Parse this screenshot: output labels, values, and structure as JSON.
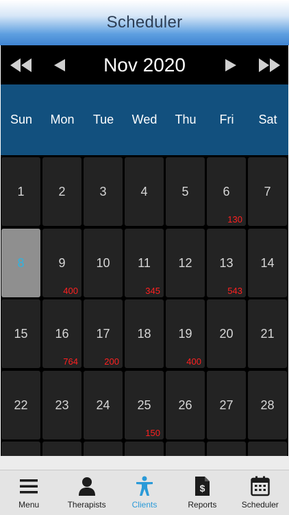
{
  "header": {
    "title": "Scheduler"
  },
  "calendar": {
    "month_label": "Nov 2020",
    "weekdays": [
      "Sun",
      "Mon",
      "Tue",
      "Wed",
      "Thu",
      "Fri",
      "Sat"
    ],
    "weeks": [
      [
        {
          "day": "1",
          "count": ""
        },
        {
          "day": "2",
          "count": ""
        },
        {
          "day": "3",
          "count": ""
        },
        {
          "day": "4",
          "count": ""
        },
        {
          "day": "5",
          "count": ""
        },
        {
          "day": "6",
          "count": "130"
        },
        {
          "day": "7",
          "count": ""
        }
      ],
      [
        {
          "day": "8",
          "count": "",
          "selected": true
        },
        {
          "day": "9",
          "count": "400"
        },
        {
          "day": "10",
          "count": ""
        },
        {
          "day": "11",
          "count": "345"
        },
        {
          "day": "12",
          "count": ""
        },
        {
          "day": "13",
          "count": "543"
        },
        {
          "day": "14",
          "count": ""
        }
      ],
      [
        {
          "day": "15",
          "count": ""
        },
        {
          "day": "16",
          "count": "764"
        },
        {
          "day": "17",
          "count": "200"
        },
        {
          "day": "18",
          "count": ""
        },
        {
          "day": "19",
          "count": "400"
        },
        {
          "day": "20",
          "count": ""
        },
        {
          "day": "21",
          "count": ""
        }
      ],
      [
        {
          "day": "22",
          "count": ""
        },
        {
          "day": "23",
          "count": ""
        },
        {
          "day": "24",
          "count": ""
        },
        {
          "day": "25",
          "count": "150"
        },
        {
          "day": "26",
          "count": ""
        },
        {
          "day": "27",
          "count": ""
        },
        {
          "day": "28",
          "count": ""
        }
      ],
      [
        {
          "day": "",
          "count": ""
        },
        {
          "day": "",
          "count": ""
        },
        {
          "day": "",
          "count": ""
        },
        {
          "day": "",
          "count": ""
        },
        {
          "day": "",
          "count": ""
        },
        {
          "day": "",
          "count": ""
        },
        {
          "day": "",
          "count": ""
        }
      ]
    ],
    "colors": {
      "selected_day_text": "#2fb3e0",
      "count_text": "#ff2020",
      "weekday_bar": "#12507e"
    }
  },
  "tabbar": {
    "items": [
      {
        "label": "Menu",
        "icon": "menu-icon"
      },
      {
        "label": "Therapists",
        "icon": "person-icon"
      },
      {
        "label": "Clients",
        "icon": "accessibility-icon",
        "active": true
      },
      {
        "label": "Reports",
        "icon": "report-document-icon"
      },
      {
        "label": "Scheduler",
        "icon": "calendar-icon"
      }
    ],
    "active_color": "#2a9ad8"
  }
}
